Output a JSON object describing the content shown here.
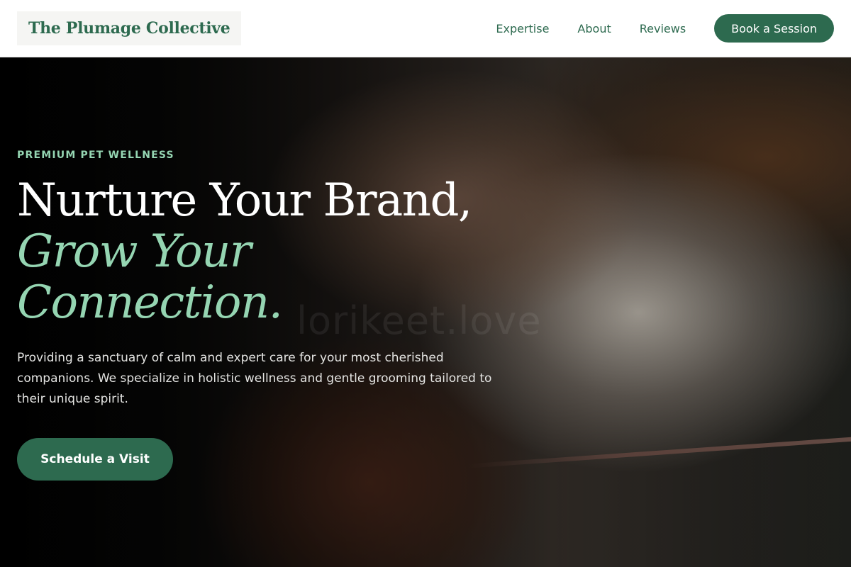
{
  "header": {
    "logo_text": "The Plumage Collective",
    "nav": [
      {
        "label": "Expertise"
      },
      {
        "label": "About"
      },
      {
        "label": "Reviews"
      }
    ],
    "book_label": "Book a Session"
  },
  "hero": {
    "eyebrow": "PREMIUM PET WELLNESS",
    "headline_line1": "Nurture Your Brand,",
    "headline_accent": "Grow Your Connection.",
    "description": "Providing a sanctuary of calm and expert care for your most cherished companions. We specialize in holistic wellness and gentle grooming tailored to their unique spirit.",
    "cta_label": "Schedule a Visit",
    "watermark": "lorikeet.love"
  },
  "colors": {
    "brand_green": "#2d6a4f",
    "accent_mint": "#95d5b2"
  }
}
